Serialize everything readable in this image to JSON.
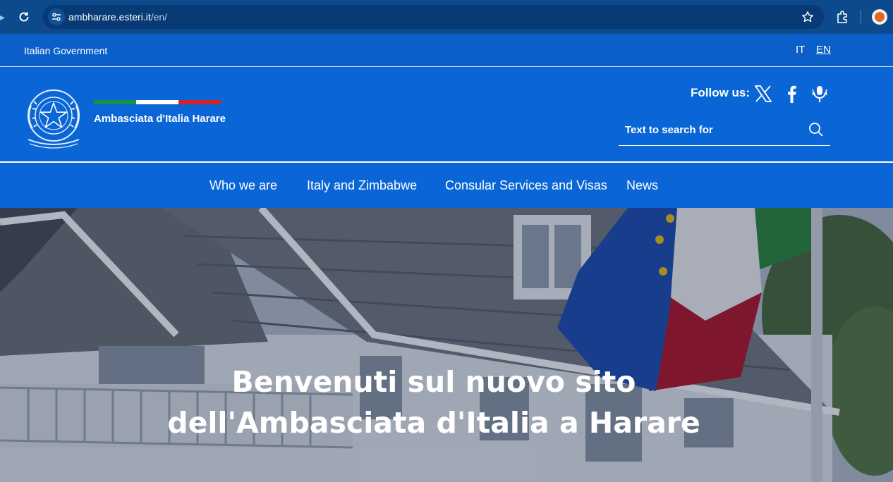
{
  "browser": {
    "url_host": "ambharare.esteri.it",
    "url_path": "/en/"
  },
  "gov_bar": {
    "label": "Italian Government",
    "languages": [
      "IT",
      "EN"
    ],
    "active_language": "EN"
  },
  "header": {
    "site_title": "Ambasciata d'Italia Harare",
    "flag_colors": [
      "#159447",
      "#ffffff",
      "#d2232a"
    ],
    "follow_label": "Follow us:",
    "social": [
      "x-icon",
      "facebook-icon",
      "podcast-icon"
    ],
    "search_placeholder": "Text to search for"
  },
  "nav": {
    "items": [
      "Who we are",
      "Italy and Zimbabwe",
      "Consular Services and Visas",
      "News"
    ]
  },
  "hero": {
    "title_line1": "Benvenuti sul nuovo sito",
    "title_line2": "dell'Ambasciata d'Italia a Harare"
  },
  "colors": {
    "brand_blue": "#0a66d6",
    "chrome_dark": "#0c4a8c"
  }
}
